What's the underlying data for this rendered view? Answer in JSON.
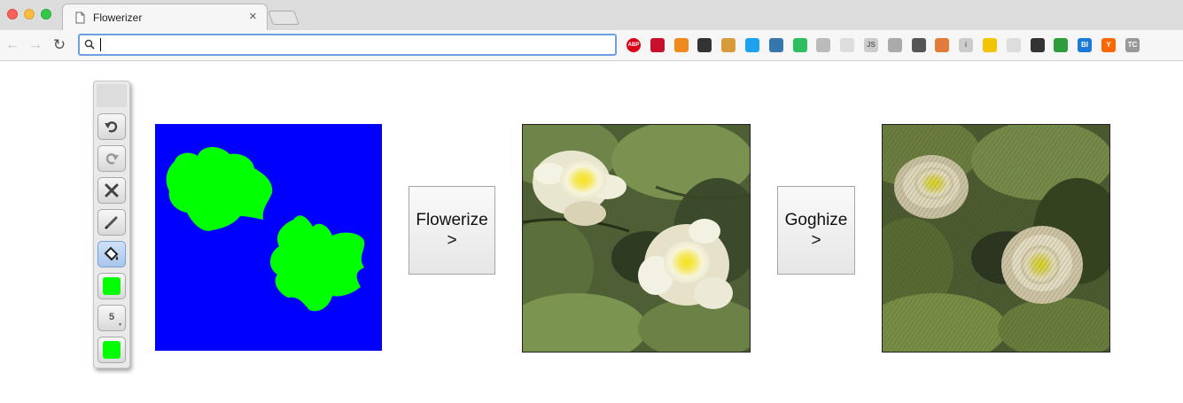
{
  "browser": {
    "tab_title": "Flowerizer",
    "tab_close": "×",
    "address_value": "",
    "nav": {
      "back": "←",
      "forward": "→",
      "reload": "↻"
    }
  },
  "extensions": [
    {
      "name": "adblock-plus-icon",
      "label": "ABP",
      "color": "#d9001b"
    },
    {
      "name": "extension-red-icon",
      "label": "",
      "color": "#c8102e"
    },
    {
      "name": "chart-extension-icon",
      "label": "",
      "color": "#f08a1c"
    },
    {
      "name": "tab-manager-icon",
      "label": "",
      "color": "#333333"
    },
    {
      "name": "cookie-icon",
      "label": "",
      "color": "#d99a3b"
    },
    {
      "name": "twitter-icon",
      "label": "",
      "color": "#1da1f2"
    },
    {
      "name": "python-icon",
      "label": "",
      "color": "#3776ab"
    },
    {
      "name": "evernote-icon",
      "label": "",
      "color": "#2dbe60"
    },
    {
      "name": "dots-circle-icon",
      "label": "",
      "color": "#bbbbbb"
    },
    {
      "name": "cursor-extension-icon",
      "label": "",
      "color": "#dddddd"
    },
    {
      "name": "js-search-icon",
      "label": "JS",
      "color": "#cccccc"
    },
    {
      "name": "gear-ring-icon",
      "label": "",
      "color": "#aaaaaa"
    },
    {
      "name": "eyedropper-icon",
      "label": "",
      "color": "#555555"
    },
    {
      "name": "tools-icon",
      "label": "",
      "color": "#e07b39"
    },
    {
      "name": "info-icon",
      "label": "i",
      "color": "#cccccc"
    },
    {
      "name": "lightbulb-icon",
      "label": "",
      "color": "#f5c400"
    },
    {
      "name": "circle-gray-icon",
      "label": "",
      "color": "#dddddd"
    },
    {
      "name": "pen-icon",
      "label": "",
      "color": "#333333"
    },
    {
      "name": "tree-icon",
      "label": "",
      "color": "#2e9e3c"
    },
    {
      "name": "bi-icon",
      "label": "BI",
      "color": "#1a7ad8"
    },
    {
      "name": "hacker-news-icon",
      "label": "Y",
      "color": "#ff6600"
    },
    {
      "name": "tc-icon",
      "label": "TC",
      "color": "#999999"
    }
  ],
  "palette": {
    "brush_size": "5",
    "stroke_color": "#00ff00",
    "fill_color": "#00ff00",
    "active_tool": "fill-bucket"
  },
  "main": {
    "canvas_background": "#0000ff",
    "blob_color": "#00ff00",
    "flowerize_button": {
      "line1": "Flowerize",
      "line2": ">"
    },
    "goghize_button": {
      "line1": "Goghize",
      "line2": ">"
    }
  }
}
